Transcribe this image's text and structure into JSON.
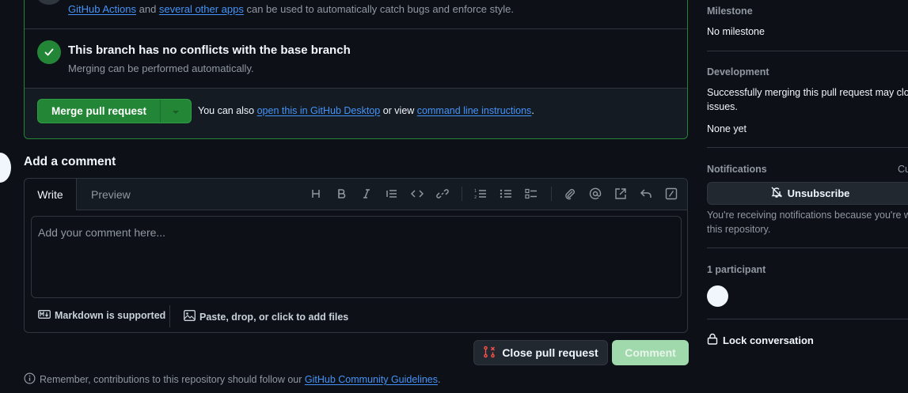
{
  "merge_box": {
    "checks_text_link1": "GitHub Actions",
    "checks_text_mid": " and ",
    "checks_text_link2": "several other apps",
    "checks_text_end": " can be used to automatically catch bugs and enforce style.",
    "conflict_title": "This branch has no conflicts with the base branch",
    "conflict_sub": "Merging can be performed automatically.",
    "merge_button_label": "Merge pull request",
    "alt_prefix": "You can also ",
    "alt_link1": "open this in GitHub Desktop",
    "alt_mid": " or view ",
    "alt_link2": "command line instructions",
    "alt_end": "."
  },
  "comment": {
    "title": "Add a comment",
    "tab_write": "Write",
    "tab_preview": "Preview",
    "placeholder": "Add your comment here...",
    "markdown_label": "Markdown is supported",
    "attach_label": "Paste, drop, or click to add files",
    "toolbar_icons": [
      "heading-icon",
      "bold-icon",
      "italic-icon",
      "quote-icon",
      "code-icon",
      "link-icon",
      "ordered-list-icon",
      "unordered-list-icon",
      "task-list-icon",
      "attach-icon",
      "mention-icon",
      "reference-icon",
      "reply-icon",
      "slash-command-icon"
    ]
  },
  "actions": {
    "close_label": "Close pull request",
    "comment_label": "Comment"
  },
  "reminder": {
    "prefix": "Remember, contributions to this repository should follow our ",
    "link": "GitHub Community Guidelines",
    "end": "."
  },
  "sidebar": {
    "milestone_head": "Milestone",
    "milestone_value": "No milestone",
    "development_head": "Development",
    "development_text1": "Successfully merging this pull request may close",
    "development_text2": "issues.",
    "development_value": "None yet",
    "notifications_head": "Notifications",
    "notifications_custom": "Cu",
    "unsubscribe_label": "Unsubscribe",
    "notify_text1": "You're receiving notifications because you're wa",
    "notify_text2": "this repository.",
    "participants": "1 participant",
    "lock_label": "Lock conversation"
  },
  "colors": {
    "merge_green": "#238636",
    "link_blue": "#4493f8",
    "close_red": "#f85149",
    "background": "#0d1117"
  }
}
